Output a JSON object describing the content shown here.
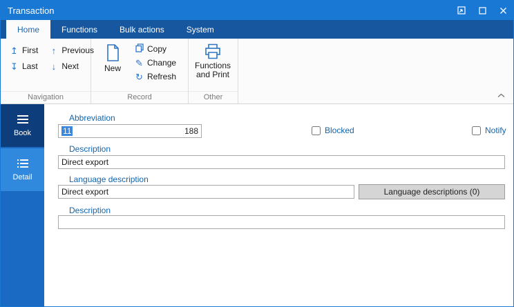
{
  "window": {
    "title": "Transaction"
  },
  "ribbon": {
    "tabs": [
      {
        "label": "Home"
      },
      {
        "label": "Functions"
      },
      {
        "label": "Bulk actions"
      },
      {
        "label": "System"
      }
    ],
    "navigation": {
      "group_label": "Navigation",
      "first": "First",
      "previous": "Previous",
      "last": "Last",
      "next": "Next"
    },
    "record": {
      "group_label": "Record",
      "new": "New",
      "copy": "Copy",
      "change": "Change",
      "refresh": "Refresh"
    },
    "other": {
      "group_label": "Other",
      "functions_print": "Functions and Print"
    }
  },
  "sidebar": {
    "book": "Book",
    "detail": "Detail"
  },
  "form": {
    "abbreviation_label": "Abbreviation",
    "abbreviation_value": "11",
    "abbreviation_count": "188",
    "blocked_label": "Blocked",
    "notify_label": "Notify",
    "description_label": "Description",
    "description_value": "Direct export",
    "language_description_label": "Language description",
    "language_description_value": "Direct export",
    "language_descriptions_button": "Language descriptions (0)",
    "description2_label": "Description",
    "description2_value": ""
  },
  "colors": {
    "accent": "#1878d4",
    "tabstrip": "#16579f",
    "label_blue": "#1464ac",
    "icon_blue": "#2e75c5"
  }
}
